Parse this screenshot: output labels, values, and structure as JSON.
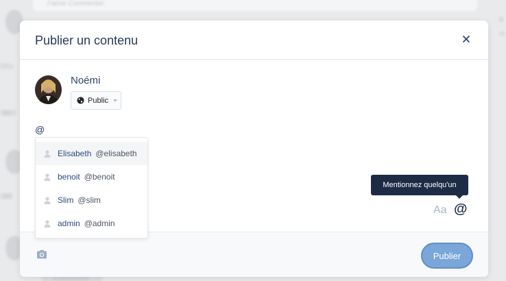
{
  "background": {
    "top_card_text": "J'aime   Commenter",
    "side_labels": [
      "B",
      "re",
      "es",
      "ə",
      "ɔ /"
    ],
    "bottom_text": "Commenter"
  },
  "modal": {
    "title": "Publier un contenu",
    "close_icon": "close-icon",
    "author": {
      "name": "Noémi",
      "privacy_label": "Public"
    },
    "editor_text": "@",
    "mention_suggestions": [
      {
        "name": "Elisabeth",
        "handle": "@elisabeth",
        "active": true
      },
      {
        "name": "benoit",
        "handle": "@benoit",
        "active": false
      },
      {
        "name": "Slim",
        "handle": "@slim",
        "active": false
      },
      {
        "name": "admin",
        "handle": "@admin",
        "active": false
      }
    ],
    "tooltip": "Mentionnez quelqu'un",
    "format_label": "Aa",
    "mention_label": "@",
    "publish_label": "Publier"
  },
  "colors": {
    "accent": "#7aa6d9",
    "title": "#263a5a",
    "tooltip_bg": "#1d2b45"
  }
}
